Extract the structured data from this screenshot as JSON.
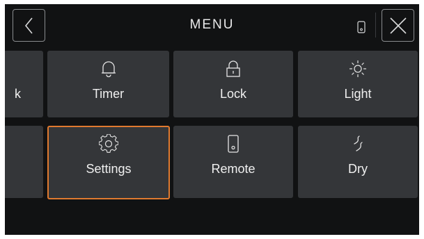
{
  "header": {
    "title": "MENU",
    "back_icon": "chevron-left-icon",
    "close_icon": "close-icon",
    "remote_icon": "remote-icon"
  },
  "tiles": [
    {
      "label": "k",
      "icon": "none",
      "partial": true
    },
    {
      "label": "Timer",
      "icon": "bell-icon"
    },
    {
      "label": "Lock",
      "icon": "lock-icon"
    },
    {
      "label": "Light",
      "icon": "sun-icon"
    },
    {
      "label": "",
      "icon": "none",
      "partial": true
    },
    {
      "label": "Settings",
      "icon": "gear-icon",
      "selected": true
    },
    {
      "label": "Remote",
      "icon": "remote-icon"
    },
    {
      "label": "Dry",
      "icon": "dry-wave-icon"
    }
  ],
  "colors": {
    "background": "#111213",
    "tile": "#343639",
    "selection": "#e07a2f",
    "text": "#f0f0f0"
  }
}
